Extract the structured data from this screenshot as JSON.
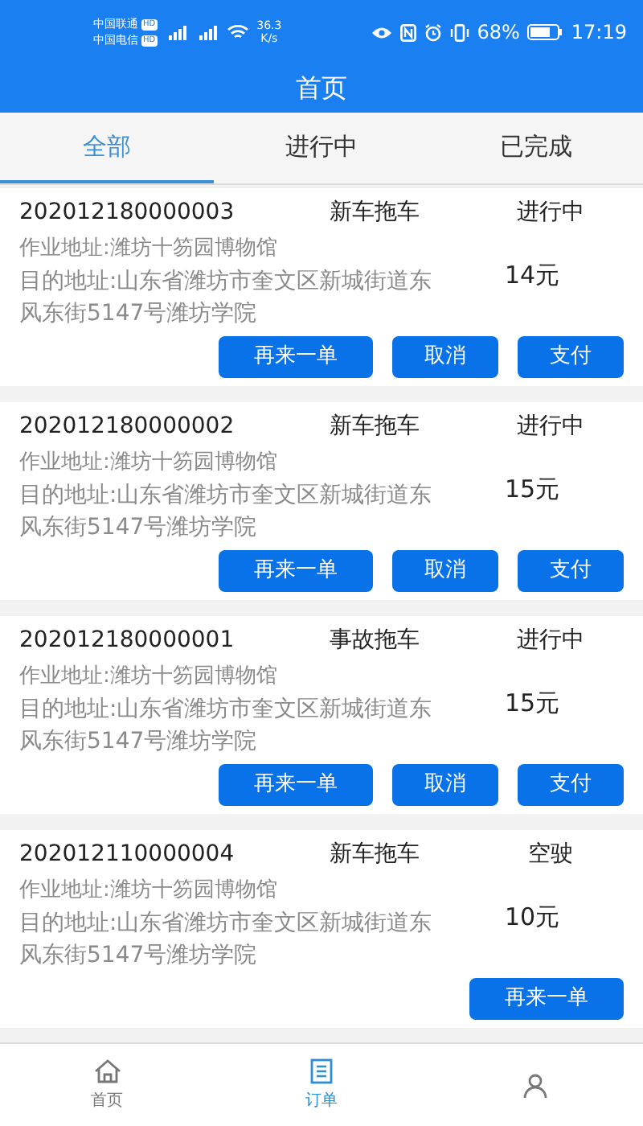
{
  "status_bar": {
    "carriers": [
      {
        "name": "中国联通",
        "badge": "HD"
      },
      {
        "name": "中国电信",
        "badge": "HD"
      }
    ],
    "network_speed": "36.3",
    "speed_unit": "K/s",
    "battery": "68%",
    "time": "17:19"
  },
  "header": {
    "title": "首页"
  },
  "tabs": [
    {
      "label": "全部",
      "selected": true
    },
    {
      "label": "进行中",
      "selected": false
    },
    {
      "label": "已完成",
      "selected": false
    }
  ],
  "orders": [
    {
      "id": "202012180000003",
      "type": "新车拖车",
      "status": "进行中",
      "work_address": "作业地址:潍坊十笏园博物馆",
      "destination": "目的地址:山东省潍坊市奎文区新城街道东风东街5147号潍坊学院",
      "price": "14元",
      "buttons": [
        {
          "label": "再来一单",
          "kind": "wide"
        },
        {
          "label": "取消",
          "kind": "narrow"
        },
        {
          "label": "支付",
          "kind": "narrow"
        }
      ]
    },
    {
      "id": "202012180000002",
      "type": "新车拖车",
      "status": "进行中",
      "work_address": "作业地址:潍坊十笏园博物馆",
      "destination": "目的地址:山东省潍坊市奎文区新城街道东风东街5147号潍坊学院",
      "price": "15元",
      "buttons": [
        {
          "label": "再来一单",
          "kind": "wide"
        },
        {
          "label": "取消",
          "kind": "narrow"
        },
        {
          "label": "支付",
          "kind": "narrow"
        }
      ]
    },
    {
      "id": "202012180000001",
      "type": "事故拖车",
      "status": "进行中",
      "work_address": "作业地址:潍坊十笏园博物馆",
      "destination": "目的地址:山东省潍坊市奎文区新城街道东风东街5147号潍坊学院",
      "price": "15元",
      "buttons": [
        {
          "label": "再来一单",
          "kind": "wide"
        },
        {
          "label": "取消",
          "kind": "narrow"
        },
        {
          "label": "支付",
          "kind": "narrow"
        }
      ]
    },
    {
      "id": "202012110000004",
      "type": "新车拖车",
      "status": "空驶",
      "work_address": "作业地址:潍坊十笏园博物馆",
      "destination": "目的地址:山东省潍坊市奎文区新城街道东风东街5147号潍坊学院",
      "price": "10元",
      "buttons": [
        {
          "label": "再来一单",
          "kind": "wide"
        }
      ]
    }
  ],
  "bottom_nav": [
    {
      "label": "首页",
      "kind": "home",
      "selected": false
    },
    {
      "label": "订单",
      "kind": "list",
      "selected": true
    },
    {
      "kind": "person",
      "selected": false
    }
  ]
}
